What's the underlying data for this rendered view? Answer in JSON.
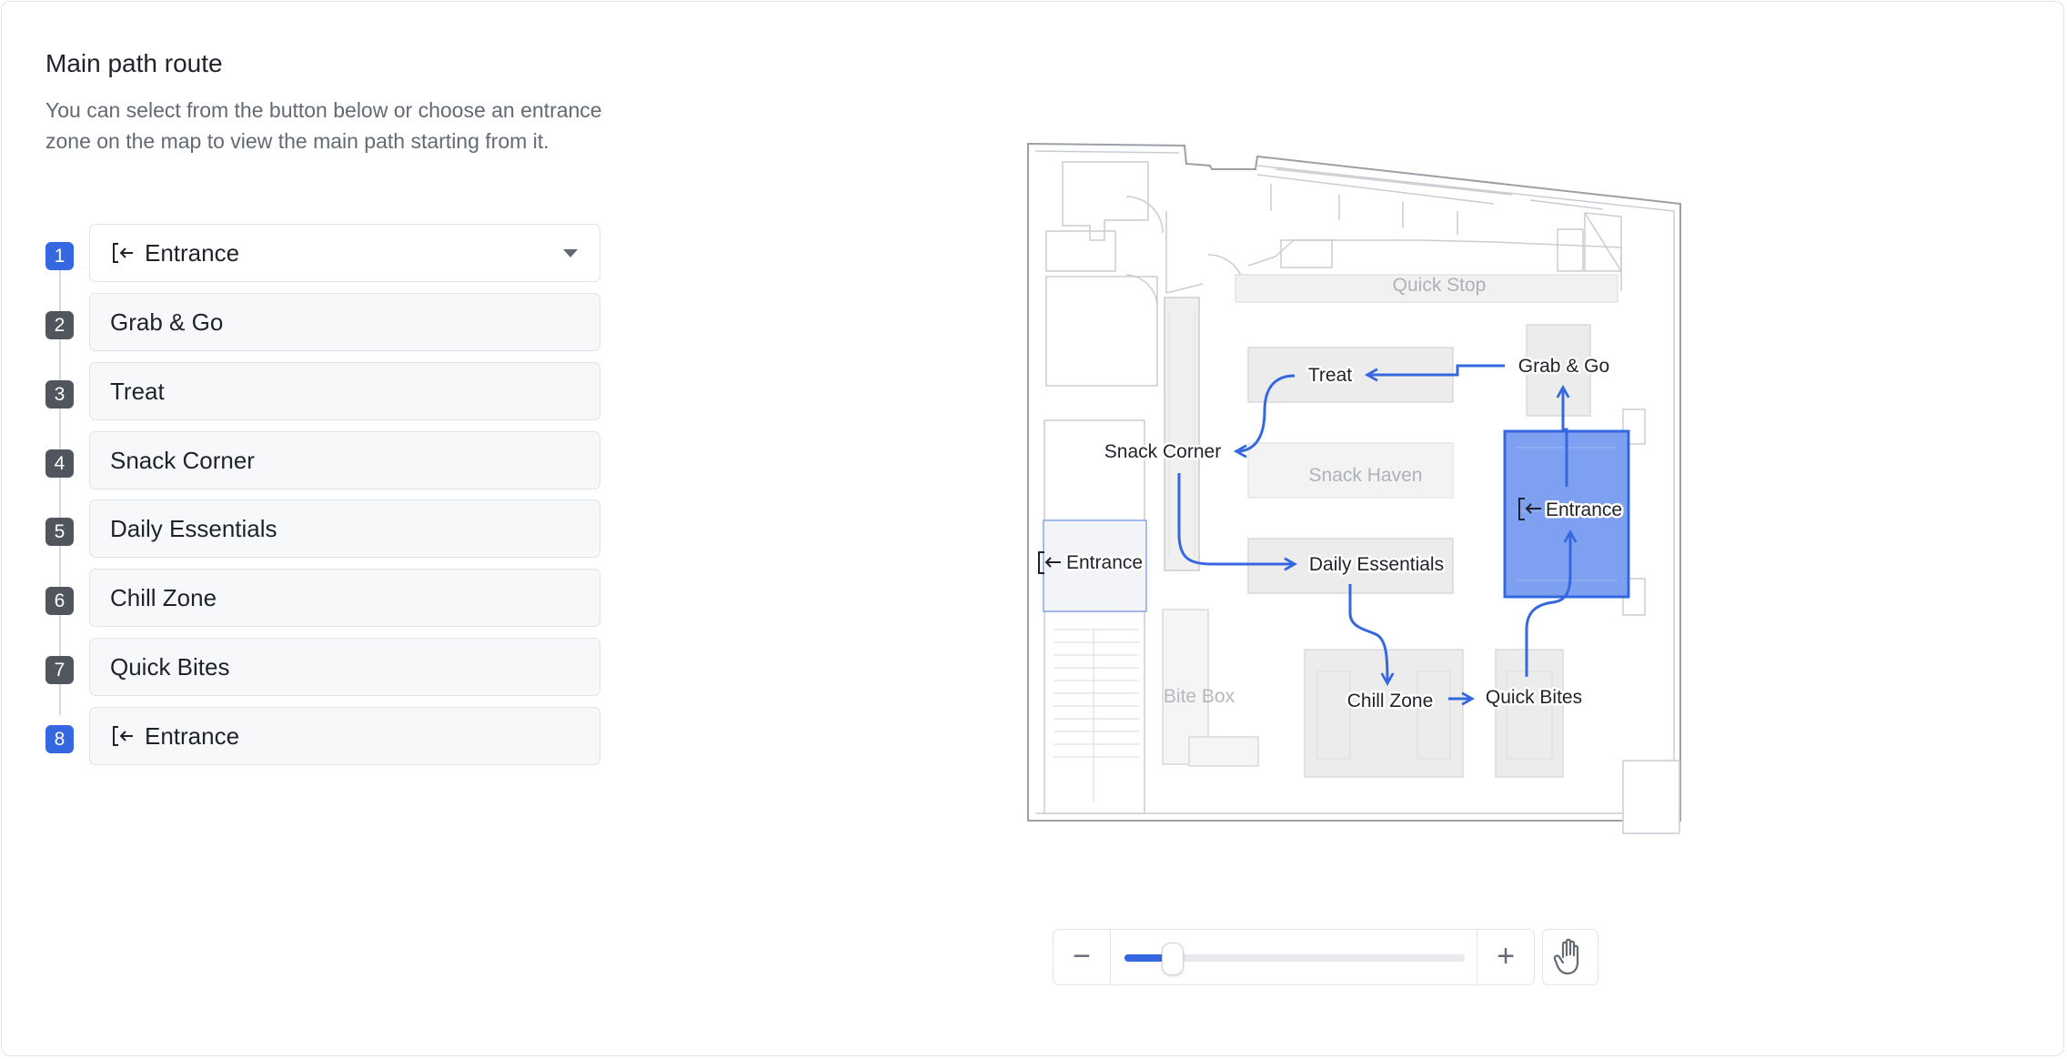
{
  "panel": {
    "title": "Main path route",
    "description": "You can select from the button below or choose an entrance zone on the map to view the main path starting from it."
  },
  "steps": [
    {
      "number": "1",
      "label": "Entrance",
      "icon": "entrance-icon",
      "type": "select"
    },
    {
      "number": "2",
      "label": "Grab & Go"
    },
    {
      "number": "3",
      "label": "Treat"
    },
    {
      "number": "4",
      "label": "Snack Corner"
    },
    {
      "number": "5",
      "label": "Daily Essentials"
    },
    {
      "number": "6",
      "label": "Chill Zone"
    },
    {
      "number": "7",
      "label": "Quick Bites"
    },
    {
      "number": "8",
      "label": "Entrance",
      "icon": "entrance-icon"
    }
  ],
  "map": {
    "zones": {
      "quick_stop": "Quick Stop",
      "grab_go": "Grab & Go",
      "treat": "Treat",
      "snack_corner": "Snack Corner",
      "snack_haven": "Snack Haven",
      "entrance_left": "Entrance",
      "daily_essentials": "Daily Essentials",
      "entrance_right": "Entrance",
      "bite_box": "Bite Box",
      "chill_zone": "Chill Zone",
      "quick_bites": "Quick Bites"
    },
    "route_color": "#3568e0",
    "selected_zone": "Entrance"
  },
  "zoom": {
    "minus_label": "−",
    "plus_label": "+",
    "level": 0.14,
    "pan_icon": "hand-icon"
  },
  "colors": {
    "accent": "#3568e0",
    "step_badge": "#51565e",
    "zone_fill": "#ececec"
  }
}
